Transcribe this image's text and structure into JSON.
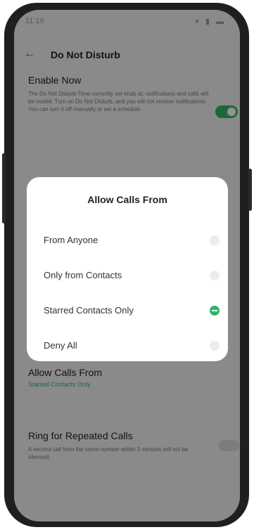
{
  "statusbar": {
    "time": "11:16",
    "icons": "▾ ▮ ▬"
  },
  "appbar": {
    "back": "←",
    "title": "Do Not Disturb"
  },
  "enable": {
    "label": "Enable Now",
    "desc": "The Do Not Disturb Time currently set ends at, notifications and calls will be muted. Turn on Do Not Disturb, and you will not receive notifications. You can turn it off manually or set a schedule."
  },
  "allow": {
    "title": "Allow Calls From",
    "value": "Starred Contacts Only"
  },
  "ring": {
    "title": "Ring for Repeated Calls",
    "desc": "A second call from the same number within 3 minutes will not be silenced."
  },
  "dialog": {
    "title": "Allow Calls From",
    "options": [
      {
        "label": "From Anyone",
        "selected": false
      },
      {
        "label": "Only from Contacts",
        "selected": false
      },
      {
        "label": "Starred Contacts Only",
        "selected": true
      },
      {
        "label": "Deny All",
        "selected": false
      }
    ]
  },
  "colors": {
    "accent": "#2fb36a"
  }
}
